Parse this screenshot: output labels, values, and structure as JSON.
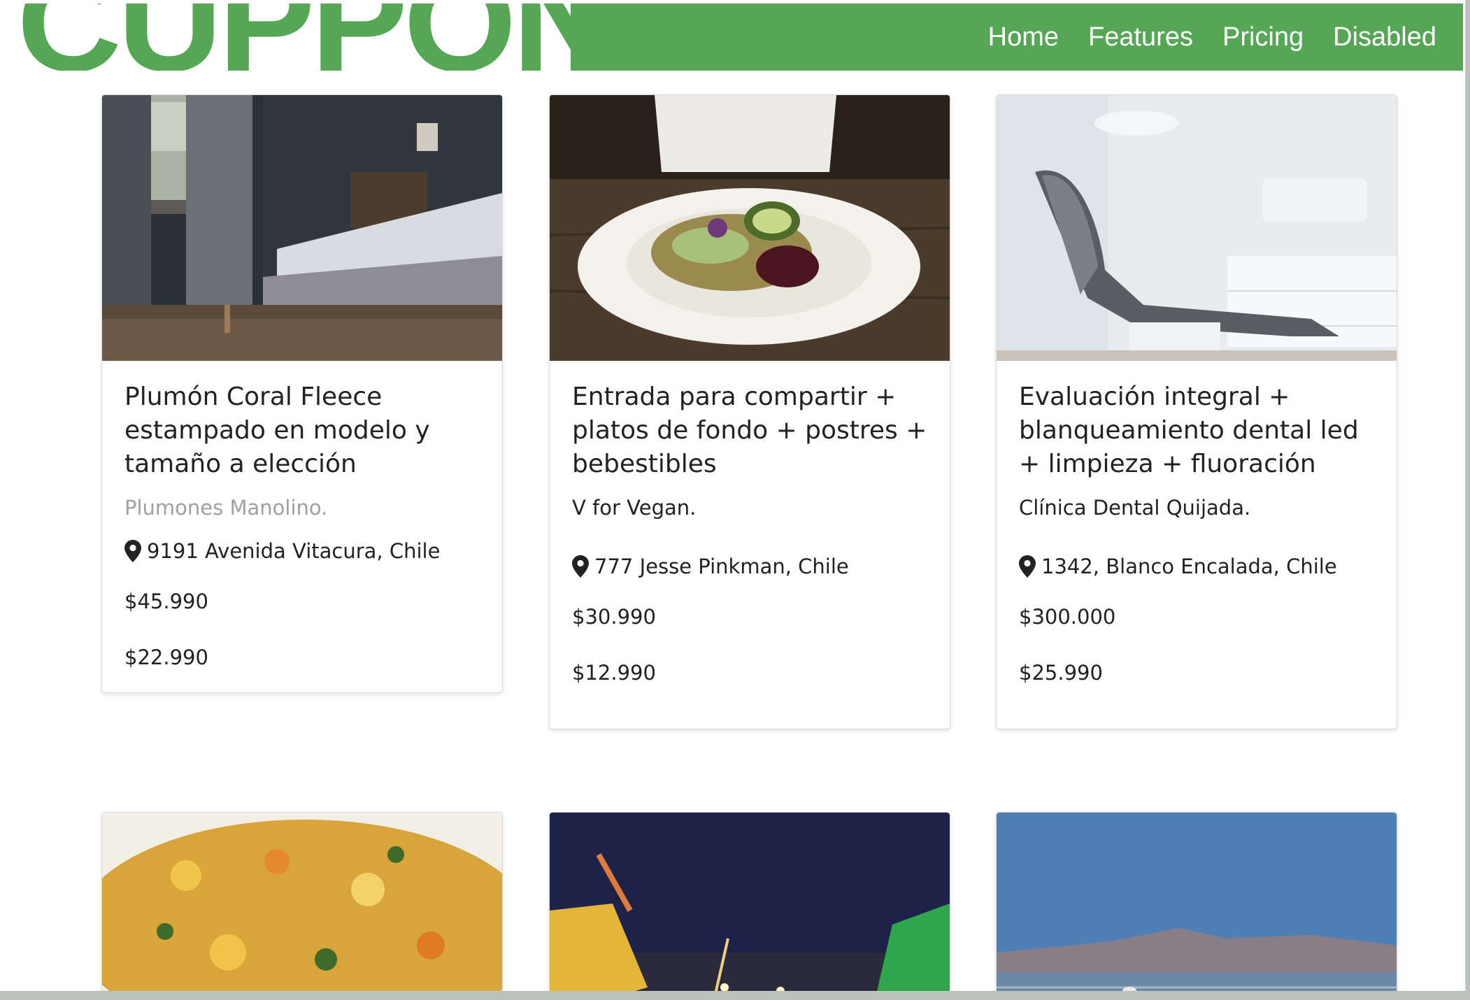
{
  "brand": {
    "logo_text": "CUPPON"
  },
  "nav": {
    "links": [
      {
        "label": "Home"
      },
      {
        "label": "Features"
      },
      {
        "label": "Pricing"
      },
      {
        "label": "Disabled"
      }
    ]
  },
  "cards": [
    {
      "title": "Plumón Coral Fleece estampado en modelo y tamaño a elección",
      "vendor": "Plumones Manolino.",
      "address": "9191 Avenida Vitacura, Chile",
      "price_original": "$45.990",
      "price_offer": "$22.990"
    },
    {
      "title": "Entrada para compartir + platos de fondo + postres + bebestibles",
      "vendor": "V for Vegan.",
      "address": "777 Jesse Pinkman, Chile",
      "price_original": "$30.990",
      "price_offer": "$12.990"
    },
    {
      "title": "Evaluación integral + blanqueamiento dental led + limpieza + fluoración",
      "vendor": "Clínica Dental Quijada.",
      "address": "1342, Blanco Encalada, Chile",
      "price_original": "$300.000",
      "price_offer": "$25.990"
    }
  ],
  "colors": {
    "brand_green": "#55a755",
    "muted_text": "#a0a0a0",
    "body_text": "#222222"
  },
  "icons": [
    "map-marker-icon"
  ]
}
